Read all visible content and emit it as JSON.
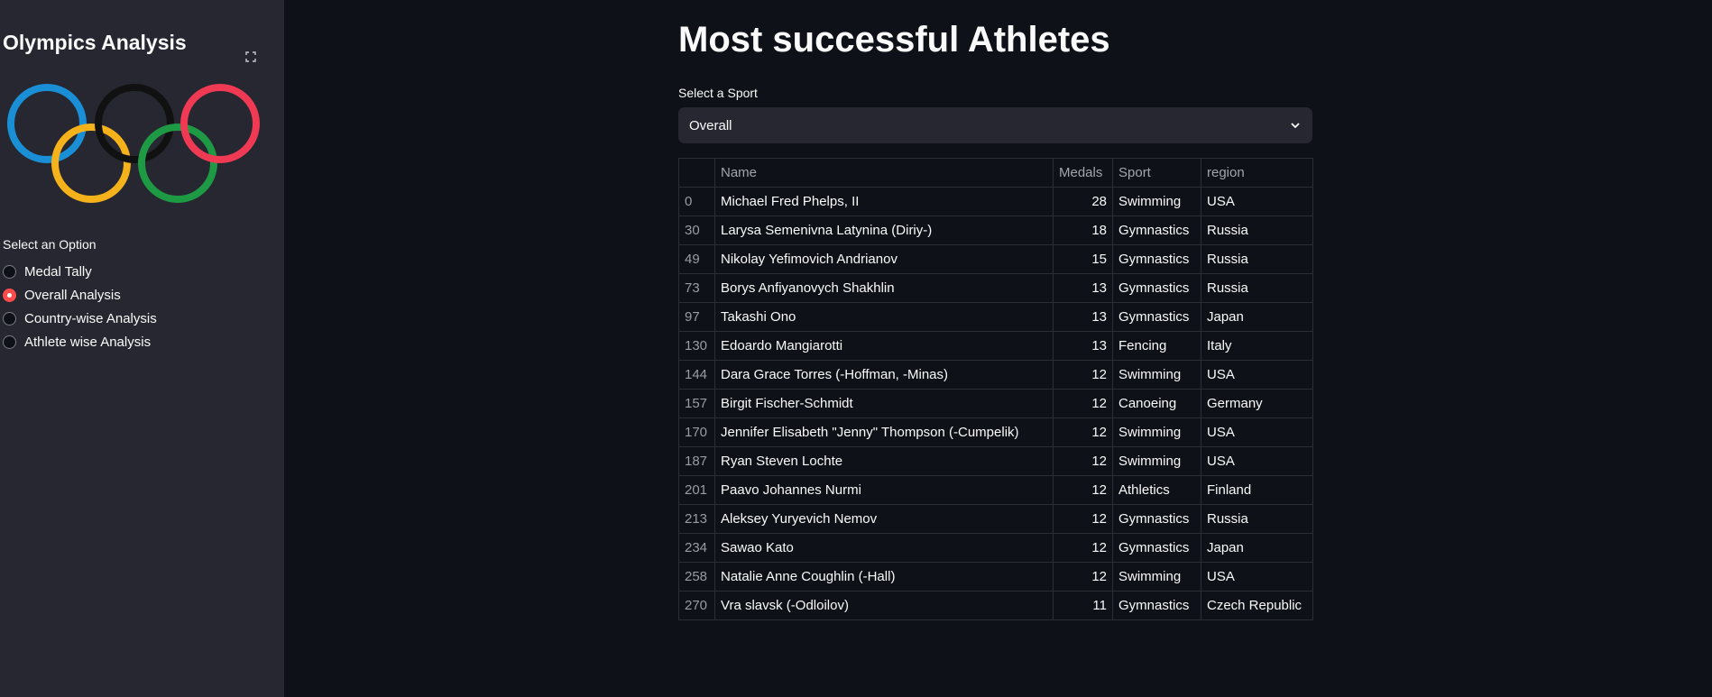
{
  "sidebar": {
    "title": "Olympics Analysis",
    "logo_icon": "olympic-rings",
    "ring_colors": [
      "#1b8fd6",
      "#f5b21b",
      "#111111",
      "#1e9a45",
      "#f03a54"
    ],
    "option_label": "Select an Option",
    "options": [
      {
        "label": "Medal Tally",
        "selected": false
      },
      {
        "label": "Overall Analysis",
        "selected": true
      },
      {
        "label": "Country-wise Analysis",
        "selected": false
      },
      {
        "label": "Athlete wise Analysis",
        "selected": false
      }
    ],
    "accent_color": "#ff4b4b"
  },
  "main": {
    "title": "Most successful Athletes",
    "select": {
      "label": "Select a Sport",
      "value": "Overall"
    },
    "table": {
      "columns": [
        "",
        "Name",
        "Medals",
        "Sport",
        "region"
      ],
      "rows": [
        [
          "0",
          "Michael Fred Phelps, II",
          "28",
          "Swimming",
          "USA"
        ],
        [
          "30",
          "Larysa Semenivna Latynina (Diriy-)",
          "18",
          "Gymnastics",
          "Russia"
        ],
        [
          "49",
          "Nikolay Yefimovich Andrianov",
          "15",
          "Gymnastics",
          "Russia"
        ],
        [
          "73",
          "Borys Anfiyanovych Shakhlin",
          "13",
          "Gymnastics",
          "Russia"
        ],
        [
          "97",
          "Takashi Ono",
          "13",
          "Gymnastics",
          "Japan"
        ],
        [
          "130",
          "Edoardo Mangiarotti",
          "13",
          "Fencing",
          "Italy"
        ],
        [
          "144",
          "Dara Grace Torres (-Hoffman, -Minas)",
          "12",
          "Swimming",
          "USA"
        ],
        [
          "157",
          "Birgit Fischer-Schmidt",
          "12",
          "Canoeing",
          "Germany"
        ],
        [
          "170",
          "Jennifer Elisabeth \"Jenny\" Thompson (-Cumpelik)",
          "12",
          "Swimming",
          "USA"
        ],
        [
          "187",
          "Ryan Steven Lochte",
          "12",
          "Swimming",
          "USA"
        ],
        [
          "201",
          "Paavo Johannes Nurmi",
          "12",
          "Athletics",
          "Finland"
        ],
        [
          "213",
          "Aleksey Yuryevich Nemov",
          "12",
          "Gymnastics",
          "Russia"
        ],
        [
          "234",
          "Sawao Kato",
          "12",
          "Gymnastics",
          "Japan"
        ],
        [
          "258",
          "Natalie Anne Coughlin (-Hall)",
          "12",
          "Swimming",
          "USA"
        ],
        [
          "270",
          "Vra slavsk (-Odloilov)",
          "11",
          "Gymnastics",
          "Czech Republic"
        ]
      ]
    }
  }
}
